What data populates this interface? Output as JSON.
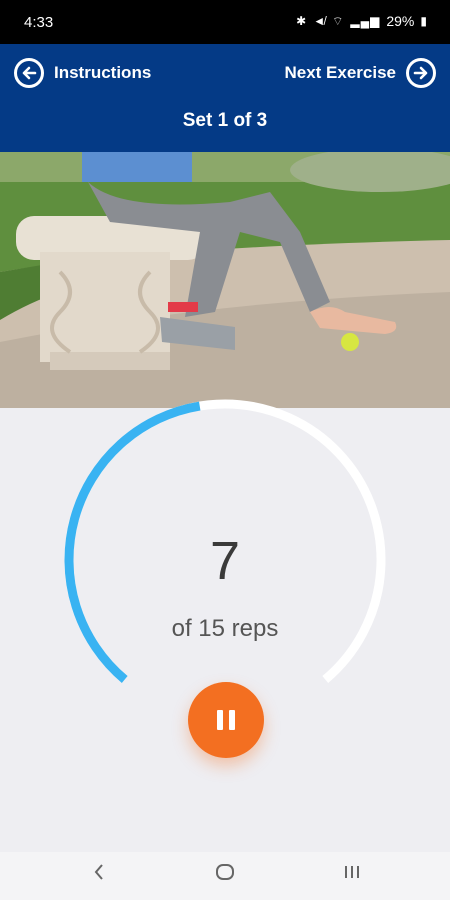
{
  "status_bar": {
    "time": "4:33",
    "battery": "29%",
    "icons": [
      "bluetooth-icon",
      "mute-icon",
      "wifi-icon",
      "signal-icon",
      "battery-icon"
    ]
  },
  "header": {
    "back_label": "Instructions",
    "next_label": "Next Exercise",
    "set_label": "Set 1 of 3",
    "color": "#043a86"
  },
  "counter": {
    "current": "7",
    "total_label": "of 15 reps",
    "progress": 0.4667,
    "progress_color": "#39b3f2",
    "track_color": "#ffffff"
  },
  "controls": {
    "pause_color": "#f36f21",
    "pause_icon": "pause-icon"
  },
  "system_nav": {
    "buttons": [
      "back-icon",
      "home-icon",
      "recents-icon"
    ]
  }
}
